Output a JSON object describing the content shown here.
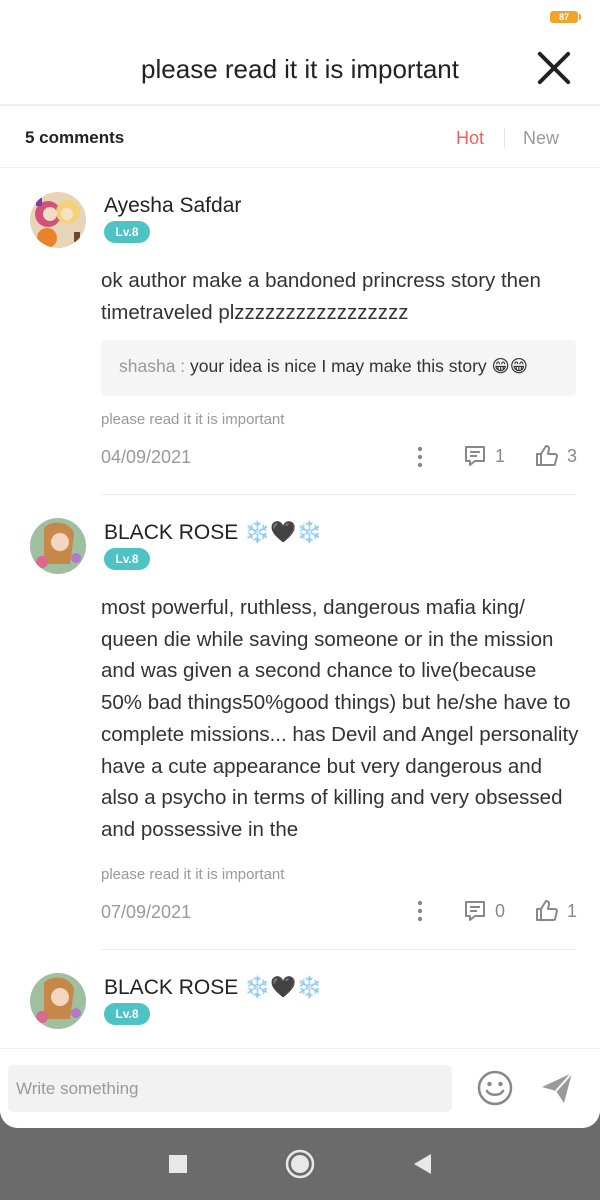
{
  "status": {
    "battery": "87"
  },
  "header": {
    "title": "please read it it is important",
    "close_icon": "close-icon"
  },
  "subheader": {
    "count_label": "5 comments",
    "sort_hot": "Hot",
    "sort_new": "New"
  },
  "comments": [
    {
      "username": "Ayesha Safdar",
      "level": "Lv.8",
      "text": "ok author make a bandoned princress story then timetraveled plzzzzzzzzzzzzzzzzz",
      "reply": {
        "author": "shasha : ",
        "text": "your idea is nice I may make this story 😁😁"
      },
      "source": "please read it it is important",
      "date": "04/09/2021",
      "reply_count": "1",
      "like_count": "3"
    },
    {
      "username": "BLACK ROSE ❄️🖤❄️",
      "level": "Lv.8",
      "text": "most powerful, ruthless, dangerous mafia king/ queen die while saving someone or in the mission and was given a second chance to live(because 50% bad things50%good things) but he/she have to complete missions... has Devil and Angel personality have a cute appearance but very dangerous and also a psycho in terms of killing and very obsessed and  possessive in the",
      "source": "please read it it is important",
      "date": "07/09/2021",
      "reply_count": "0",
      "like_count": "1"
    },
    {
      "username": "BLACK ROSE ❄️🖤❄️",
      "level": "Lv.8"
    }
  ],
  "composer": {
    "placeholder": "Write something"
  },
  "colors": {
    "accent": "#f06060",
    "level_badge": "#4ec3c6",
    "battery": "#f0a52a"
  }
}
